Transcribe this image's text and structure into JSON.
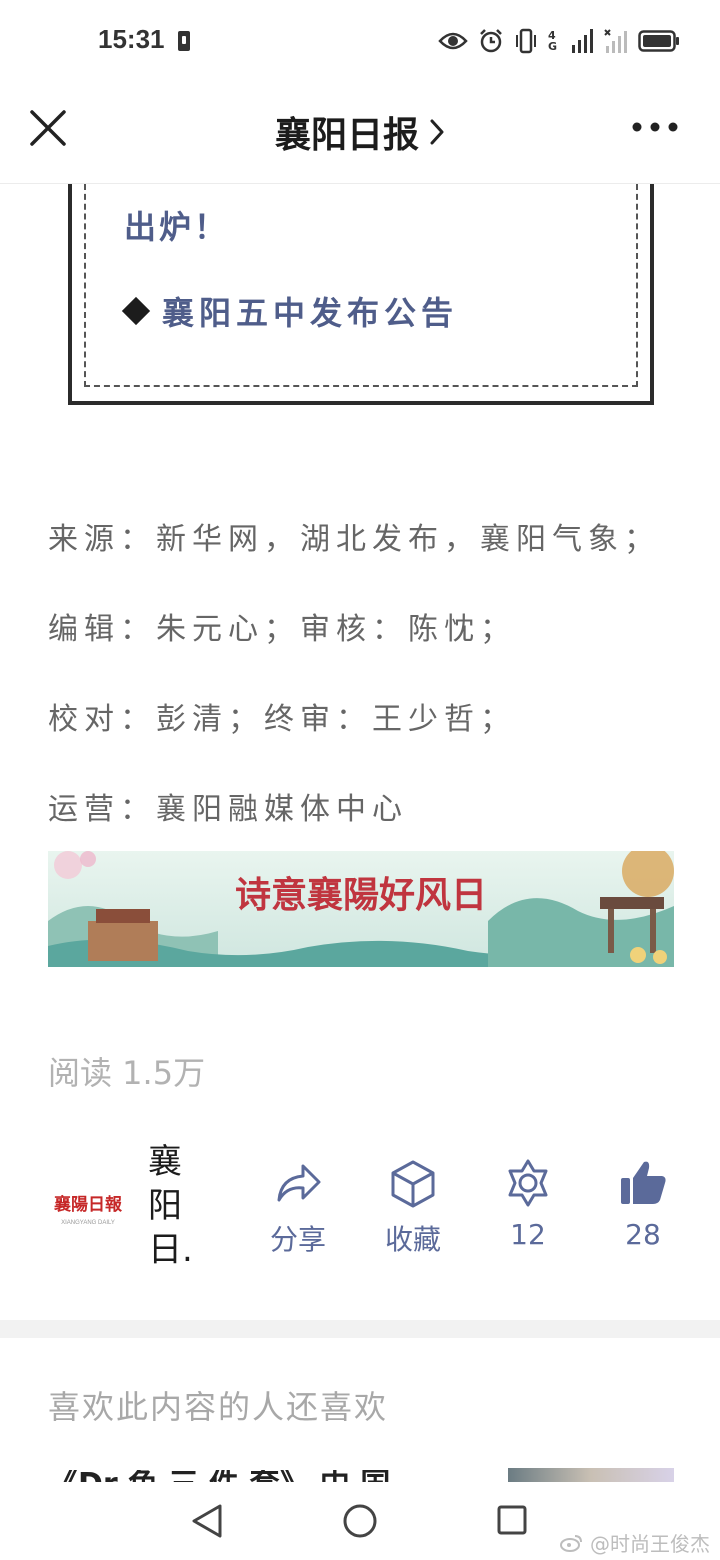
{
  "status_bar": {
    "time": "15:31",
    "network": "4G"
  },
  "nav": {
    "title": "襄阳日报"
  },
  "boxed": {
    "line1": "出炉！",
    "line2": "襄阳五中发布公告"
  },
  "credits": [
    "来源：新华网，湖北发布，襄阳气象；",
    "编辑：朱元心；审核：陈忱；",
    "校对：彭清；终审：王少哲；",
    "运营：襄阳融媒体中心"
  ],
  "banner": {
    "text": "诗意襄陽好风日",
    "colors": {
      "sky": "#dbeee8",
      "text": "#c0353f"
    }
  },
  "read_count": "阅读 1.5万",
  "account": {
    "logo_text": "襄陽日報",
    "logo_subtext": "XIANGYANG DAILY",
    "name": "襄阳日."
  },
  "actions": {
    "share": "分享",
    "favorite": "收藏",
    "wow_count": "12",
    "like_count": "28",
    "accent_color": "#5b6a9a"
  },
  "recommend": {
    "title": "喜欢此内容的人还喜欢",
    "peek_text": "《Dr 色 三 件 套》 中 国 ："
  },
  "watermark": "@时尚王俊杰"
}
